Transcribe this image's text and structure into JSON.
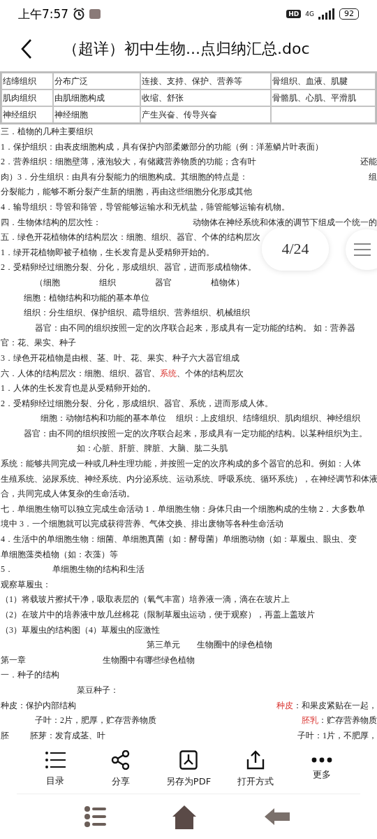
{
  "status_bar": {
    "time": "上午7:57",
    "hd": "HD",
    "network": "4G",
    "battery": "92"
  },
  "header": {
    "title": "（超详）初中生物...点归纳汇总.doc"
  },
  "table": {
    "rows": [
      [
        "结缔组织",
        "分布广泛",
        "连接、支持、保护、营养等",
        "骨组织、血液、肌腱"
      ],
      [
        "肌肉组织",
        "由肌细胞构成",
        "收缩、舒张",
        "骨骼肌、心肌、平滑肌"
      ],
      [
        "神经组织",
        "神经细胞",
        "产生兴奋、传导兴奋"
      ]
    ]
  },
  "lines": [
    {
      "kind": "plain",
      "text": "三．植物的几种主要组织"
    },
    {
      "kind": "plain",
      "text": "1．保护组织：由表皮细胞构成，具有保护内部柔嫩部分的功能（例：洋葱鳞片叶表面）"
    },
    {
      "kind": "spread",
      "parts": [
        "2．营养组织：细胞壁薄，液泡较大，有储藏营养物质的功能；含有叶",
        "还能"
      ]
    },
    {
      "kind": "spread",
      "parts": [
        "肉）3．分生组织：由具有分裂能力的细胞构成。其细胞的特点是：",
        "组"
      ]
    },
    {
      "kind": "plain",
      "text": "分裂能力，能够不断分裂产生新的细胞，再由这些细胞分化形成其他"
    },
    {
      "kind": "plain",
      "text": "4．输导组织：导管和筛管，导管能够运输水和无机盐，筛管能够运输有机物。"
    },
    {
      "kind": "spread",
      "parts": [
        "四．生物体结构的层次性：",
        "动物体在神经系统和体液的调节下组成一个统一的"
      ]
    },
    {
      "kind": "plain",
      "text": "五．绿色开花植物体的结构层次：细胞、组织、器官、个体的结构层次"
    },
    {
      "kind": "plain",
      "text": "1．绿开花植物即被子植物，生长发育是从受精卵开始的。"
    },
    {
      "kind": "plain",
      "text": "2．受精卵经过细胞分裂、分化，形成组织、器官，进而形成植物体。"
    },
    {
      "kind": "columns",
      "parts": [
        "（细胞",
        "组织",
        "器官",
        "植物体）"
      ]
    },
    {
      "kind": "indented",
      "text": "细胞：植物结构和功能的基本单位"
    },
    {
      "kind": "indented",
      "text": "组织：分生组织、保护组织、疏导组织、营养组织、机械组织"
    },
    {
      "kind": "deep",
      "text": "器官：由不同的组织按照一定的次序联合起来，形成具有一定功能的结构。 如：营养器"
    },
    {
      "kind": "plain",
      "text": "官：花、果实、种子"
    },
    {
      "kind": "plain",
      "text": "3．绿色开花植物是由根、茎、叶、花、果实、种子六大器官组成"
    },
    {
      "kind": "marked",
      "segments": [
        {
          "text": "六．人体的结构层次：细胞、组织、器官、",
          "highlight": false
        },
        {
          "text": "系统",
          "highlight": true
        },
        {
          "text": "、个体的结构层次",
          "highlight": false
        }
      ]
    },
    {
      "kind": "plain",
      "text": "1．人体的生长发育也是从受精卵开始的。"
    },
    {
      "kind": "plain",
      "text": "2．受精卵经过细胞分裂、分化，形成组织、器官、系统，进而形成人体。"
    },
    {
      "kind": "pair",
      "parts": [
        "细胞：动物结构和功能的基本单位",
        "组织：上皮组织、结缔组织、肌肉组织、神经组织"
      ]
    },
    {
      "kind": "indented",
      "text": "器官：由不同的组织按照一定的次序联合起来，形成具有一定功能的结构。以某种组织为主。"
    },
    {
      "kind": "deeper",
      "text": "如：心脏、肝脏、脾脏、大脑、肱二头肌"
    },
    {
      "kind": "plain",
      "text": "系统：能够共同完成一种或几种生理功能，并按照一定的次序构成的多个器官的总和。例如：人体"
    },
    {
      "kind": "plain",
      "text": "生殖系统、泌尿系统、神经系统、内分泌系统、运动系统、呼吸系统、循环系统），在神经调节和体液"
    },
    {
      "kind": "plain",
      "text": "合，共同完成人体复杂的生命活动。"
    },
    {
      "kind": "plain",
      "text": "七．单细胞生物可以独立完成生命活动 1．单细胞生物：身体只由一个细胞构成的生物 2．大多数单"
    },
    {
      "kind": "plain",
      "text": "境中 3．一个细胞就可以完成获得营养、气体交换、排出废物等各种生命活动"
    },
    {
      "kind": "plain",
      "text": "4．生活中的单细胞生物：细菌、单细胞真菌（如：酵母菌）单细胞动物（如：草履虫、眼虫、变"
    },
    {
      "kind": "plain",
      "text": "单细胞藻类植物（如：衣藻）等"
    },
    {
      "kind": "gap",
      "parts": [
        "5．",
        "单细胞生物的结构和生活"
      ]
    },
    {
      "kind": "plain",
      "text": "观察草履虫："
    },
    {
      "kind": "plain",
      "text": "（1）将载玻片擦拭干净，吸取表层的（氧气丰富）培养液一滴，滴在在玻片上"
    },
    {
      "kind": "plain",
      "text": "（2）在玻片中的培养液中放几丝棉花（限制草履虫运动，便于观察），再盖上盖玻片"
    },
    {
      "kind": "plain",
      "text": "（3）草履虫的结构图（4）草履虫的应激性"
    },
    {
      "kind": "center",
      "parts": [
        "第三单元",
        "生物圈中的绿色植物"
      ]
    },
    {
      "kind": "wide",
      "parts": [
        "第一章",
        "生物圈中有哪些绿色植物"
      ]
    },
    {
      "kind": "plain",
      "text": "一．种子的结构"
    },
    {
      "kind": "deeper",
      "text": "菜豆种子："
    },
    {
      "kind": "spread",
      "parts": [
        "种皮：保护内部结构",
        {
          "segments": [
            {
              "text": "种皮",
              "highlight": true
            },
            {
              "text": "：和果皮紧贴在一起，",
              "highlight": false
            }
          ]
        }
      ]
    },
    {
      "kind": "spread-indented",
      "parts": [
        "子叶：2片，肥厚，贮存营养物质",
        {
          "segments": [
            {
              "text": "胚乳",
              "highlight": true
            },
            {
              "text": "：贮存营养物质",
              "highlight": false
            }
          ]
        }
      ]
    },
    {
      "kind": "spread-three",
      "parts": [
        "胚",
        "胚芽：发育成茎、叶",
        "子叶：1片，不肥厚，"
      ]
    }
  ],
  "page_indicator": "4/24",
  "toolbar": [
    {
      "kind": "list",
      "label": "目录"
    },
    {
      "kind": "share",
      "label": "分享"
    },
    {
      "kind": "pdf",
      "label": "另存为PDF"
    },
    {
      "kind": "open",
      "label": "打开方式"
    },
    {
      "kind": "more",
      "label": "更多"
    }
  ]
}
